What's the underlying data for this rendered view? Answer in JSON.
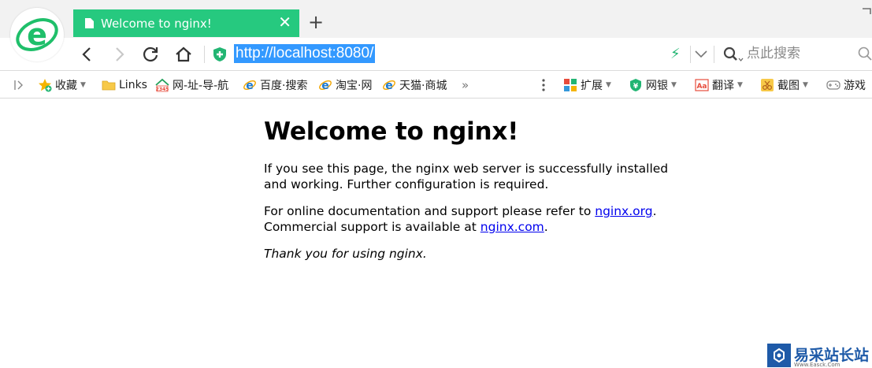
{
  "tab": {
    "title": "Welcome to nginx!",
    "close": "✕",
    "new_tab": "+"
  },
  "address": {
    "url": "http://localhost:8080/"
  },
  "search": {
    "placeholder": "点此搜索",
    "subscript": "⌄"
  },
  "bookmarks": [
    {
      "label": "收藏",
      "has_dropdown": true
    },
    {
      "label": "Links"
    },
    {
      "label": "网-址-导-航"
    },
    {
      "label": "百度·搜索"
    },
    {
      "label": "淘宝·网"
    },
    {
      "label": "天猫·商城"
    },
    {
      "label": "»"
    }
  ],
  "tools": [
    {
      "label": "扩展"
    },
    {
      "label": "网银"
    },
    {
      "label": "翻译"
    },
    {
      "label": "截图"
    },
    {
      "label": "游戏"
    }
  ],
  "page": {
    "heading": "Welcome to nginx!",
    "p1": "If you see this page, the nginx web server is successfully installed and working. Further configuration is required.",
    "p2_prefix": "For online documentation and support please refer to ",
    "p2_link": "nginx.org",
    "p2_mid": ".\nCommercial support is available at ",
    "p2_link2": "nginx.com",
    "p2_suffix": ".",
    "p3": "Thank you for using nginx."
  },
  "watermark": {
    "text": "易采站长站",
    "sub": "Www.Easck.Com"
  },
  "colors": {
    "tab_green": "#26c97f",
    "url_highlight": "#3399ff",
    "link": "#0000ee"
  }
}
